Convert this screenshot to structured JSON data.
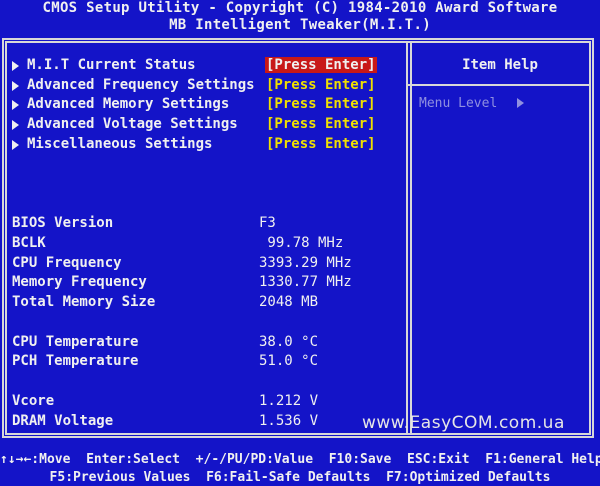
{
  "header": {
    "title": "CMOS Setup Utility - Copyright (C) 1984-2010 Award Software",
    "subtitle": "MB Intelligent Tweaker(M.I.T.)"
  },
  "menu": [
    {
      "label": "M.I.T Current Status",
      "action": "[Press Enter]",
      "selected": true
    },
    {
      "label": "Advanced Frequency Settings",
      "action": "[Press Enter]",
      "selected": false
    },
    {
      "label": "Advanced Memory Settings",
      "action": "[Press Enter]",
      "selected": false
    },
    {
      "label": "Advanced Voltage Settings",
      "action": "[Press Enter]",
      "selected": false
    },
    {
      "label": "Miscellaneous Settings",
      "action": "[Press Enter]",
      "selected": false
    }
  ],
  "info": [
    {
      "label": "BIOS Version",
      "value": "F3"
    },
    {
      "label": "BCLK",
      "value": " 99.78 MHz"
    },
    {
      "label": "CPU Frequency",
      "value": "3393.29 MHz"
    },
    {
      "label": "Memory Frequency",
      "value": "1330.77 MHz"
    },
    {
      "label": "Total Memory Size",
      "value": "2048 MB"
    },
    {
      "label": "CPU Temperature",
      "value": "38.0 °C"
    },
    {
      "label": "PCH Temperature",
      "value": "51.0 °C"
    },
    {
      "label": "Vcore",
      "value": "1.212 V"
    },
    {
      "label": "DRAM Voltage",
      "value": "1.536 V"
    }
  ],
  "help": {
    "title": "Item Help",
    "menu_level": "Menu Level"
  },
  "watermark": "www.EasyCOM.com.ua",
  "footer": {
    "line1": "↑↓→←:Move  Enter:Select  +/-/PU/PD:Value  F10:Save  ESC:Exit  F1:General Help",
    "line2": "F5:Previous Values  F6:Fail-Safe Defaults  F7:Optimized Defaults"
  },
  "colors": {
    "background": "#1414c8",
    "selected_bg": "#c81818",
    "press_enter": "#f0e000",
    "menu_level": "#9090e0"
  }
}
